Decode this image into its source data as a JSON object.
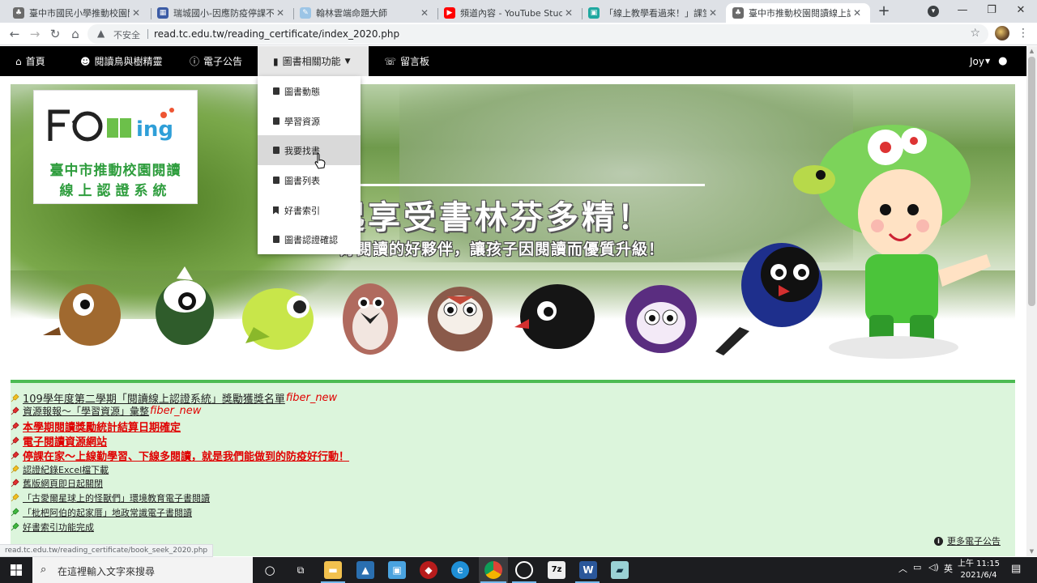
{
  "browser": {
    "tabs": [
      {
        "title": "臺中市國民小學推動校園閱讀",
        "active": false
      },
      {
        "title": "瑞城國小-因應防疫停課不停學",
        "active": false
      },
      {
        "title": "翰林雲端命題大師",
        "active": false
      },
      {
        "title": "頻道內容 - YouTube Studio",
        "active": false
      },
      {
        "title": "「線上教學看過來！」課堂作",
        "active": false
      },
      {
        "title": "臺中市推動校園閱讀線上認證",
        "active": true
      }
    ],
    "new_tab": "+",
    "window_controls": {
      "minimize": "—",
      "maximize": "❐",
      "close": "✕"
    },
    "address": {
      "security_label": "不安全",
      "url": "read.tc.edu.tw/reading_certificate/index_2020.php"
    },
    "status_url": "read.tc.edu.tw/reading_certificate/book_seek_2020.php"
  },
  "sitenav": {
    "items": [
      {
        "label": "首頁",
        "icon": "home-icon"
      },
      {
        "label": "閱讀鳥與樹精靈",
        "icon": "user-icon"
      },
      {
        "label": "電子公告",
        "icon": "info-icon"
      },
      {
        "label": "圖書相關功能",
        "icon": "books-icon"
      },
      {
        "label": "留言板",
        "icon": "comments-icon"
      }
    ],
    "user_name": "Joy"
  },
  "dropdown": {
    "items": [
      {
        "label": "圖書動態",
        "icon": "book-icon"
      },
      {
        "label": "學習資源",
        "icon": "book-icon"
      },
      {
        "label": "我要找書",
        "icon": "book-icon",
        "hovered": true
      },
      {
        "label": "圖書列表",
        "icon": "book-icon"
      },
      {
        "label": "好書索引",
        "icon": "bookmark-icon"
      },
      {
        "label": "圖書認證確認",
        "icon": "book-icon"
      }
    ]
  },
  "banner": {
    "logo_line1": "臺中市推動校園閱讀",
    "logo_line2": "線上認證系統",
    "slogan_main": "起享受書林芬多精！",
    "slogan_sub": "好閱讀的好夥伴，讓孩子因閱讀而優質升級！"
  },
  "announcements": {
    "items": [
      {
        "text": "109學年度第二學期「閱讀線上認證系統」獎勵獲獎名單",
        "tag": "fiber_new",
        "style": "normal-big",
        "pin": "yellow"
      },
      {
        "text": "資源報報～「學習資源」彙整",
        "tag": "fiber_new",
        "style": "normal",
        "pin": "red"
      },
      {
        "text": "本學期閱讀獎勵統計結算日期確定",
        "tag": "",
        "style": "red",
        "pin": "red"
      },
      {
        "text": "電子閱讀資源網站",
        "tag": "",
        "style": "red",
        "pin": "red"
      },
      {
        "text": "停課在家～上線勤學習、下線多閱讀，就是我們能做到的防疫好行動！",
        "tag": "",
        "style": "red",
        "pin": "red"
      },
      {
        "text": "認證紀錄Excel檔下載",
        "tag": "",
        "style": "small",
        "pin": "yellow"
      },
      {
        "text": "舊版網頁即日起關閉",
        "tag": "",
        "style": "small",
        "pin": "red"
      },
      {
        "text": "「古愛爾星球上的怪獸們」環境教育電子書閱讀",
        "tag": "",
        "style": "small",
        "pin": "yellow"
      },
      {
        "text": "「枇杷阿伯的起家厝」地政常識電子書閱讀",
        "tag": "",
        "style": "small",
        "pin": "green"
      },
      {
        "text": "好書索引功能完成",
        "tag": "",
        "style": "small",
        "pin": "green"
      }
    ],
    "more_label": "更多電子公告"
  },
  "taskbar": {
    "search_placeholder": "在這裡輸入文字來搜尋",
    "ime": "英",
    "time": "上午 11:15",
    "date": "2021/6/4"
  },
  "colors": {
    "nav_bg": "#000000",
    "announcement_bg": "#dcf5dc",
    "announcement_border": "#4cbb52",
    "logo_green": "#2e9d3d",
    "link_red": "#e00000"
  }
}
